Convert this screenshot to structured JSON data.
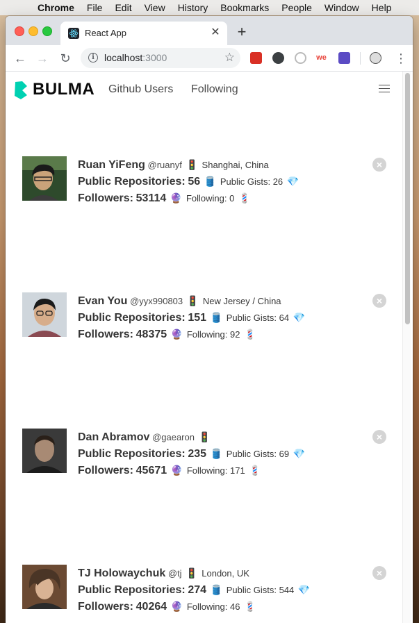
{
  "menubar": {
    "app_name": "Chrome",
    "items": [
      "File",
      "Edit",
      "View",
      "History",
      "Bookmarks",
      "People",
      "Window",
      "Help"
    ]
  },
  "browser": {
    "tab_title": "React App",
    "url_host": "localhost",
    "url_port": ":3000",
    "extension_label": "we"
  },
  "page": {
    "brand": "BULMA",
    "nav_links": [
      "Github Users",
      "Following"
    ],
    "labels": {
      "repos": "Public Repositories:",
      "gists": "Public Gists:",
      "followers": "Followers:",
      "following": "Following:"
    },
    "users": [
      {
        "name": "Ruan YiFeng",
        "handle": "@ruanyf",
        "location": "Shanghai, China",
        "public_repos": "56",
        "public_gists": "26",
        "followers": "53114",
        "following": "0"
      },
      {
        "name": "Evan You",
        "handle": "@yyx990803",
        "location": "New Jersey / China",
        "public_repos": "151",
        "public_gists": "64",
        "followers": "48375",
        "following": "92"
      },
      {
        "name": "Dan Abramov",
        "handle": "@gaearon",
        "location": "",
        "public_repos": "235",
        "public_gists": "69",
        "followers": "45671",
        "following": "171"
      },
      {
        "name": "TJ Holowaychuk",
        "handle": "@tj",
        "location": "London, UK",
        "public_repos": "274",
        "public_gists": "544",
        "followers": "40264",
        "following": "46"
      }
    ]
  },
  "colors": {
    "brand_accent": "#00d1b2",
    "text_dark": "#363636",
    "delete_button": "#d4d4d4"
  },
  "icons": {
    "location": "traffic-light-icon",
    "repos": "oil-drum-icon",
    "gists": "gem-icon",
    "followers": "crystal-ball-icon",
    "following": "barber-pole-icon"
  }
}
